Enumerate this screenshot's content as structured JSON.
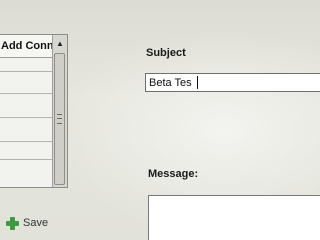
{
  "contacts": {
    "header_label": "Add Conn",
    "scroll_up_glyph": "▲"
  },
  "actions": {
    "save_label": "Save"
  },
  "form": {
    "subject_label": "Subject",
    "subject_value": "Beta Tes",
    "message_label": "Message:",
    "message_value": ""
  },
  "colors": {
    "save_icon": "#3e9a3e"
  },
  "icons": {
    "save": "plus-icon"
  }
}
